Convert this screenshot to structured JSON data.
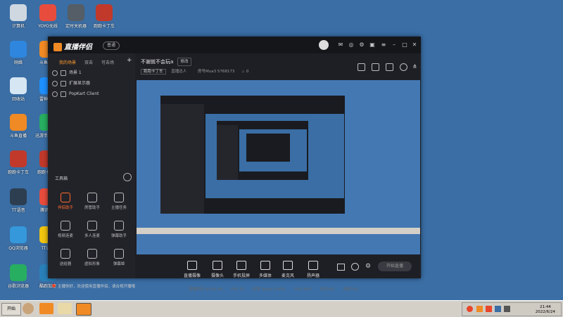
{
  "desktop_icons": [
    {
      "label": "计算机",
      "color": "#cfd8e0"
    },
    {
      "label": "YOYO无线",
      "color": "#e84c3d"
    },
    {
      "label": "定时关机器",
      "color": "#555d66"
    },
    {
      "label": "跑跑卡丁车",
      "color": "#c0392b"
    },
    {
      "label": "网络",
      "color": "#2e86de"
    },
    {
      "label": "斗鱼直播",
      "color": "#f08a24"
    },
    {
      "label": "回收站",
      "color": "#d6e6f2"
    },
    {
      "label": "雷神加速",
      "color": "#1e90ff"
    },
    {
      "label": "斗鱼直播",
      "color": "#f08a24"
    },
    {
      "label": "迅游手游加速",
      "color": "#27ae60"
    },
    {
      "label": "跑跑卡丁车",
      "color": "#c0392b"
    },
    {
      "label": "跑跑卡丁车",
      "color": "#c0392b"
    },
    {
      "label": "TT语音",
      "color": "#2c3e50"
    },
    {
      "label": "腾讯QQ",
      "color": "#e74c3c"
    },
    {
      "label": "QQ浏览器",
      "color": "#3498db"
    },
    {
      "label": "TT语音",
      "color": "#f1c40f"
    },
    {
      "label": "谷歌浏览器",
      "color": "#27ae60"
    },
    {
      "label": "酷跑加速",
      "color": "#2980b9"
    }
  ],
  "app": {
    "logo": "直播伴侣",
    "version": "普通",
    "scene_tabs": [
      "我的场景",
      "双击",
      "可去场"
    ],
    "sources": [
      "场景 1",
      "扩展显示器",
      "PopKart Client"
    ],
    "tools_title": "工具箱",
    "tools": [
      {
        "label": "伴侣助手",
        "active": true
      },
      {
        "label": "房管助手",
        "active": false
      },
      {
        "label": "主播任务",
        "active": false
      },
      {
        "label": "视频连麦",
        "active": false
      },
      {
        "label": "多人连麦",
        "active": false
      },
      {
        "label": "弹幕助手",
        "active": false
      },
      {
        "label": "送给器",
        "active": false
      },
      {
        "label": "虚拟形象",
        "active": false
      },
      {
        "label": "弹幕姬",
        "active": false
      }
    ],
    "notice": "主播你好，欢迎使用直播伴侣，请合规开播哦",
    "room_title": "不谢就不会玩a",
    "edit_label": "修改",
    "category": "跑跑卡丁车",
    "category2": "直播达人",
    "room_info": "房号Mua3 5768173",
    "bottom_tools": [
      "直播摄像",
      "摄像头",
      "手机投屏",
      "多媒体",
      "麦克风",
      "扬声器"
    ],
    "start_live": "开始直播",
    "status": [
      "直播时间 00:00:00",
      "FPS:25",
      "码率:0kb/s 0.00%",
      "CPU:24%",
      "内存:8%",
      "网络:0%"
    ]
  },
  "taskbar": {
    "start": "开始",
    "time": "21:44",
    "date": "2022/6/24"
  }
}
